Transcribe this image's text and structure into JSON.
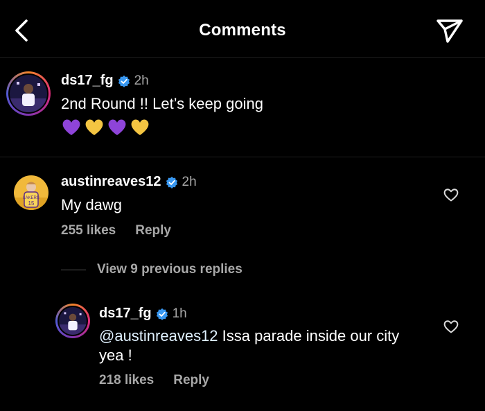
{
  "header": {
    "title": "Comments",
    "back_icon": "chevron-left-icon",
    "share_icon": "paper-plane-icon"
  },
  "caption": {
    "username": "ds17_fg",
    "verified": true,
    "time": "2h",
    "text": "2nd Round !! Let’s keep going",
    "emojis": [
      "purple-heart",
      "yellow-heart",
      "purple-heart",
      "yellow-heart"
    ]
  },
  "comments": [
    {
      "username": "austinreaves12",
      "verified": true,
      "time": "2h",
      "text": "My dawg",
      "likes": "255 likes",
      "reply_label": "Reply"
    }
  ],
  "replies_toggle": {
    "label": "View 9 previous replies"
  },
  "reply": {
    "username": "ds17_fg",
    "verified": true,
    "time": "1h",
    "mention": "@austinreaves12",
    "text_line1": " Issa parade inside our city",
    "text_line2": "yea !",
    "likes": "218 likes",
    "reply_label": "Reply"
  },
  "colors": {
    "background": "#000000",
    "secondary_text": "#a8a8a8",
    "verified_blue": "#3897f0",
    "purple_heart": "#8e44d9",
    "yellow_heart": "#f4c542",
    "lakers_gold": "#f5c242",
    "story_ring_start": "#f58529",
    "story_ring_end": "#dd2a7b"
  }
}
